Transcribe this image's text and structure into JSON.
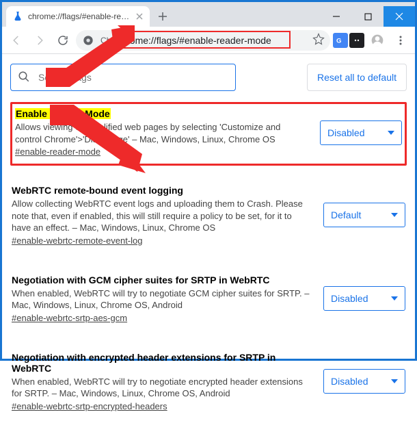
{
  "window": {
    "tab_title": "chrome://flags/#enable-reader-m"
  },
  "toolbar": {
    "security_label": "Ch",
    "url": "chrome://flags/#enable-reader-mode"
  },
  "search": {
    "placeholder": "Search flags",
    "reset_label": "Reset all to default"
  },
  "flags": [
    {
      "title": "Enable Reader Mode",
      "desc": "Allows viewing of simplified web pages by selecting 'Customize and control Chrome'>'Distill page' – Mac, Windows, Linux, Chrome OS",
      "anchor": "#enable-reader-mode",
      "value": "Disabled"
    },
    {
      "title": "WebRTC remote-bound event logging",
      "desc": "Allow collecting WebRTC event logs and uploading them to Crash. Please note that, even if enabled, this will still require a policy to be set, for it to have an effect. – Mac, Windows, Linux, Chrome OS",
      "anchor": "#enable-webrtc-remote-event-log",
      "value": "Default"
    },
    {
      "title": "Negotiation with GCM cipher suites for SRTP in WebRTC",
      "desc": "When enabled, WebRTC will try to negotiate GCM cipher suites for SRTP. – Mac, Windows, Linux, Chrome OS, Android",
      "anchor": "#enable-webrtc-srtp-aes-gcm",
      "value": "Disabled"
    },
    {
      "title": "Negotiation with encrypted header extensions for SRTP in WebRTC",
      "desc": "When enabled, WebRTC will try to negotiate encrypted header extensions for SRTP. – Mac, Windows, Linux, Chrome OS, Android",
      "anchor": "#enable-webrtc-srtp-encrypted-headers",
      "value": "Disabled"
    }
  ]
}
